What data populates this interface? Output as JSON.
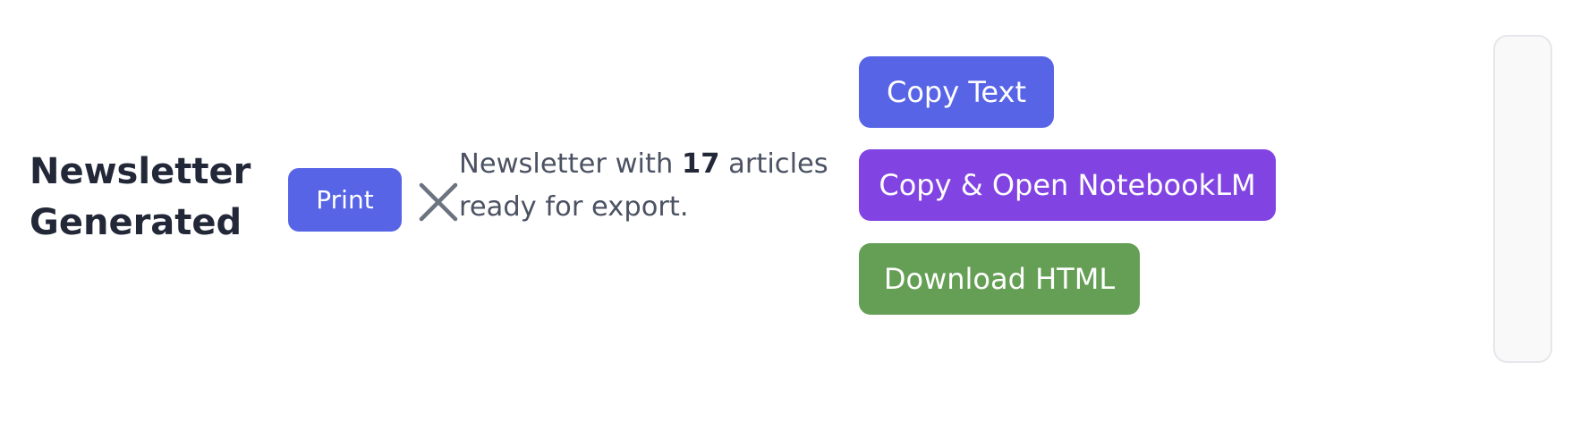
{
  "status": {
    "title": "Newsletter Generated",
    "message_prefix": "Newsletter with ",
    "article_count": "17",
    "message_suffix": " articles ready for export."
  },
  "actions": {
    "print_label": "Print",
    "close_icon": "close-icon",
    "copy_text_label": "Copy Text",
    "copy_open_notebooklm_label": "Copy & Open NotebookLM",
    "download_html_label": "Download HTML"
  },
  "colors": {
    "primary": "#5764e6",
    "purple": "#8243e3",
    "green": "#659f55",
    "heading": "#232838",
    "body_text": "#4b5262",
    "close_icon": "#6b7280"
  }
}
